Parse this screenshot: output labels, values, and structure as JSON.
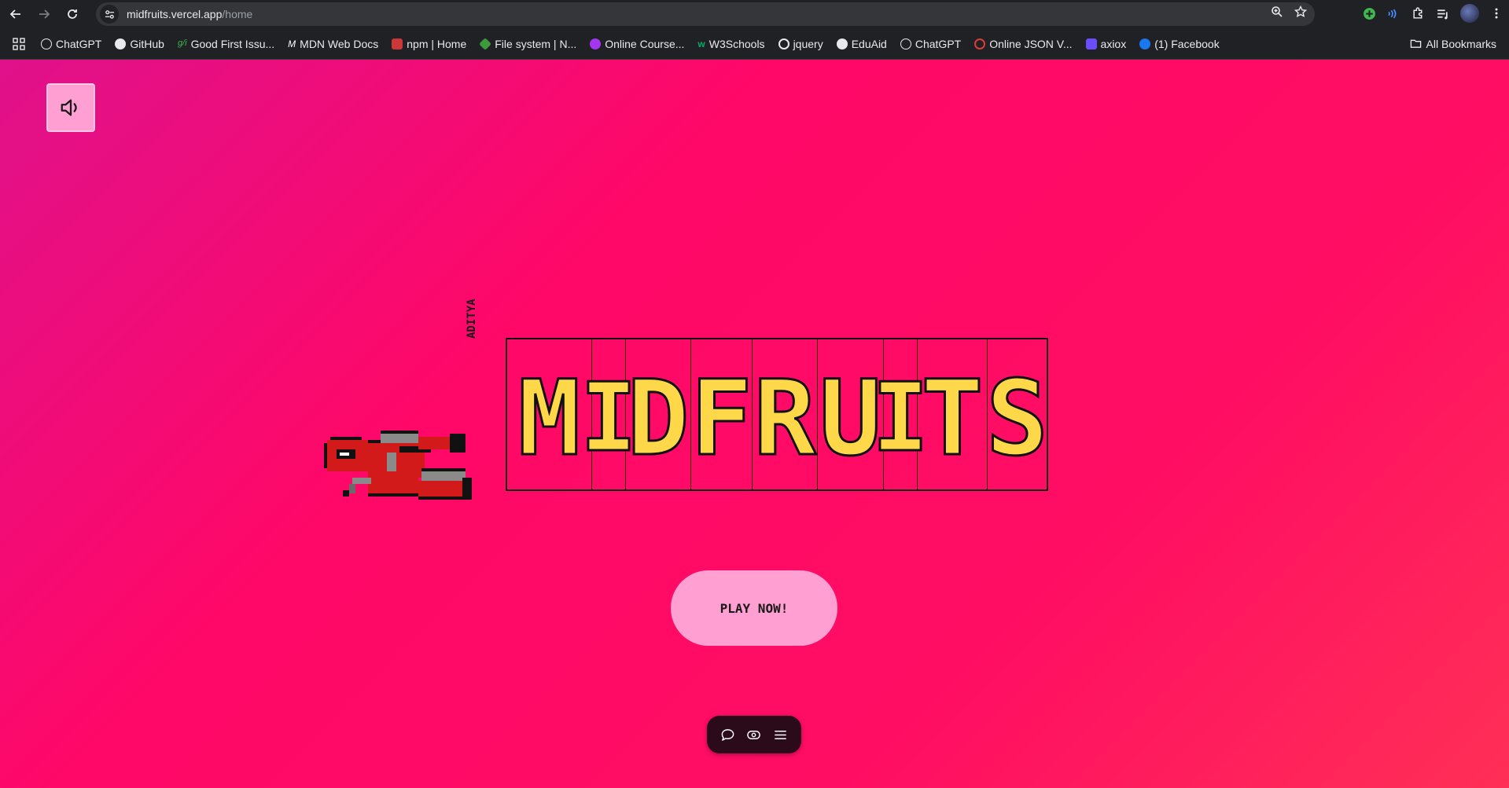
{
  "browser": {
    "url_host": "midfruits.vercel.app",
    "url_path": "/home",
    "bookmarks": [
      {
        "label": "ChatGPT",
        "icon": "chatgpt-icon",
        "color": "#e8eaed"
      },
      {
        "label": "GitHub",
        "icon": "github-icon",
        "color": "#e8eaed"
      },
      {
        "label": "Good First Issu...",
        "icon": "gfi-icon",
        "color": "#3fb950"
      },
      {
        "label": "MDN Web Docs",
        "icon": "mdn-icon",
        "color": "#ffffff"
      },
      {
        "label": "npm | Home",
        "icon": "npm-icon",
        "color": "#cb3837"
      },
      {
        "label": "File system | N...",
        "icon": "nodejs-icon",
        "color": "#3c9a3c"
      },
      {
        "label": "Online Course...",
        "icon": "udemy-icon",
        "color": "#a435f0"
      },
      {
        "label": "W3Schools",
        "icon": "w3schools-icon",
        "color": "#04aa6d"
      },
      {
        "label": "jquery",
        "icon": "google-icon",
        "color": "#ffffff"
      },
      {
        "label": "EduAid",
        "icon": "github-icon",
        "color": "#e8eaed"
      },
      {
        "label": "ChatGPT",
        "icon": "chatgpt-icon",
        "color": "#e8eaed"
      },
      {
        "label": "Online JSON V...",
        "icon": "json-icon",
        "color": "#e03a3a"
      },
      {
        "label": "axiox",
        "icon": "axiox-icon",
        "color": "#6c4cff"
      },
      {
        "label": "(1) Facebook",
        "icon": "facebook-icon",
        "color": "#1877f2"
      }
    ],
    "all_bookmarks_label": "All Bookmarks"
  },
  "page": {
    "author": "ADITYA",
    "logo_letters": [
      "M",
      "I",
      "D",
      "F",
      "R",
      "U",
      "I",
      "T",
      "S"
    ],
    "play_label": "PLAY NOW!",
    "colors": {
      "background_start": "#e0118a",
      "background_end": "#ff2f56",
      "button_pink": "#ff9fd2",
      "logo_yellow": "#ffd84a",
      "dock_dark": "#2b0a1a"
    },
    "dock_icons": [
      "chat-icon",
      "eye-icon",
      "menu-icon"
    ]
  }
}
